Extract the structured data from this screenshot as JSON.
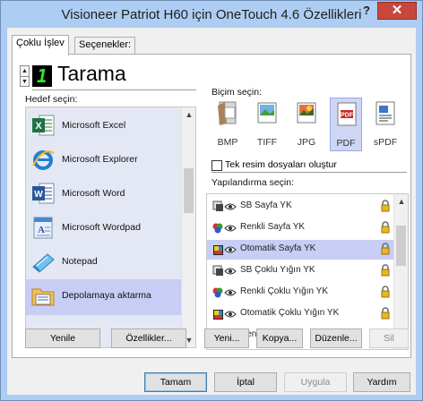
{
  "window": {
    "title": "Visioneer Patriot H60 için OneTouch 4.6 Özellikleri",
    "help_label": "?",
    "close_label": "✕"
  },
  "tabs": [
    {
      "label": "Çoklu İşlev",
      "active": true
    },
    {
      "label": "Seçenekler:",
      "active": false
    }
  ],
  "action": {
    "number": "1",
    "name": "Tarama",
    "spinner_up": "▲",
    "spinner_down": "▼"
  },
  "destination": {
    "label": "Hedef seçin:",
    "items": [
      {
        "label": "Microsoft Excel",
        "icon": "excel-icon",
        "selected": false
      },
      {
        "label": "Microsoft Explorer",
        "icon": "internet-explorer-icon",
        "selected": false
      },
      {
        "label": "Microsoft Word",
        "icon": "word-icon",
        "selected": false
      },
      {
        "label": "Microsoft Wordpad",
        "icon": "wordpad-icon",
        "selected": false
      },
      {
        "label": "Notepad",
        "icon": "notepad-icon",
        "selected": false
      },
      {
        "label": "Depolamaya aktarma",
        "icon": "storage-folder-icon",
        "selected": true
      }
    ]
  },
  "format": {
    "label": "Biçim seçin:",
    "items": [
      {
        "label": "BMP",
        "icon": "bmp-icon",
        "selected": false
      },
      {
        "label": "TIFF",
        "icon": "tiff-icon",
        "selected": false
      },
      {
        "label": "JPG",
        "icon": "jpg-icon",
        "selected": false
      },
      {
        "label": "PDF",
        "icon": "pdf-icon",
        "selected": true
      },
      {
        "label": "sPDF",
        "icon": "spdf-icon",
        "selected": false
      }
    ],
    "single_image_label": "Tek resim dosyaları oluştur",
    "single_image_checked": false
  },
  "configuration": {
    "label": "Yapılandırma seçin:",
    "items": [
      {
        "label": "SB Sayfa YK",
        "icon": "bw-scan-icon",
        "selected": false
      },
      {
        "label": "Renkli Sayfa YK",
        "icon": "color-scan-icon",
        "selected": false
      },
      {
        "label": "Otomatik Sayfa YK",
        "icon": "auto-scan-icon",
        "selected": true
      },
      {
        "label": "SB Çoklu Yığın YK",
        "icon": "bw-scan-icon",
        "selected": false
      },
      {
        "label": "Renkli Çoklu Yığın YK",
        "icon": "color-scan-icon",
        "selected": false
      },
      {
        "label": "Otomatik Çoklu Yığın YK",
        "icon": "auto-scan-icon",
        "selected": false
      },
      {
        "label": "Renkli Fotoğraf",
        "icon": "color-scan-icon",
        "selected": false
      }
    ]
  },
  "buttons": {
    "refresh": "Yenile",
    "properties": "Özellikler...",
    "new": "Yeni...",
    "copy": "Kopya...",
    "edit": "Düzenle...",
    "delete": "Sil",
    "ok": "Tamam",
    "cancel": "İptal",
    "apply": "Uygula",
    "help": "Yardım"
  },
  "colors": {
    "selection": "#c7cdf4",
    "frame": "#aecdf2",
    "close": "#c7473c",
    "lcd_text": "#2eea2e"
  }
}
